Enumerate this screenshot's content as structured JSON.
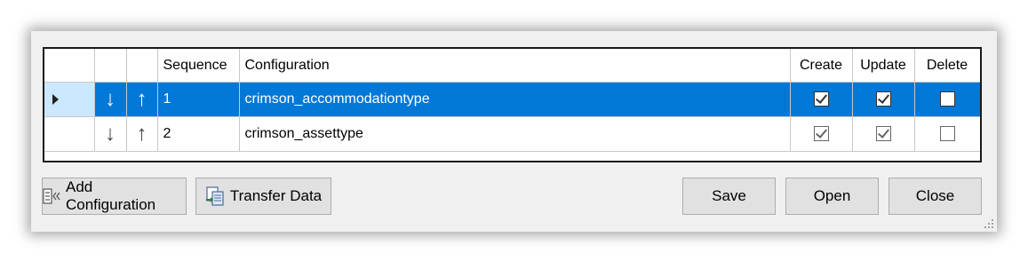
{
  "grid": {
    "columns": {
      "sequence": "Sequence",
      "configuration": "Configuration",
      "create": "Create",
      "update": "Update",
      "delete": "Delete"
    },
    "rows": [
      {
        "sequence": "1",
        "configuration": "crimson_accommodationtype",
        "create": true,
        "update": true,
        "delete": false,
        "selected": true
      },
      {
        "sequence": "2",
        "configuration": "crimson_assettype",
        "create": true,
        "update": true,
        "delete": false,
        "selected": false
      }
    ],
    "move_down_glyph": "↓",
    "move_up_glyph": "↑"
  },
  "buttons": {
    "add_configuration": "Add Configuration",
    "transfer_data": "Transfer Data",
    "save": "Save",
    "open": "Open",
    "close": "Close"
  },
  "colors": {
    "selection": "#0078d7",
    "row_header_selected": "#cce8ff",
    "button_face": "#e1e1e1",
    "window_bg": "#f0f0f0"
  }
}
